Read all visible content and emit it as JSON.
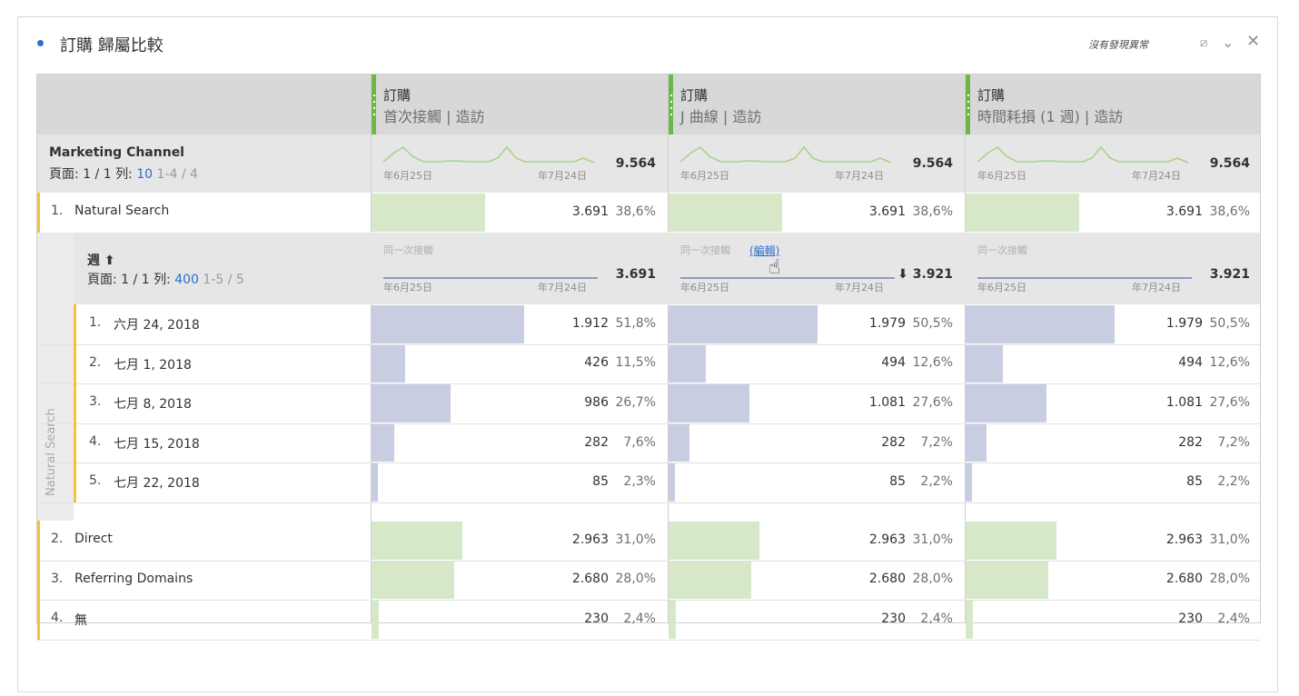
{
  "panel": {
    "title": "訂購 歸屬比較",
    "anomaly_text": "沒有發現異常",
    "controls": [
      "resize-icon",
      "chevron-down-icon",
      "close-icon"
    ]
  },
  "columns": [
    {
      "metric": "訂購",
      "model": "首次接觸 | 造訪",
      "total": "9.564",
      "sub_label": "同一次接觸",
      "sub_total": "3.691",
      "sub_total_arrow": false,
      "edit_label": ""
    },
    {
      "metric": "訂購",
      "model": "J 曲線 | 造訪",
      "total": "9.564",
      "sub_label": "同一次接觸",
      "sub_total": "3.921",
      "sub_total_arrow": true,
      "edit_label": "(編輯)"
    },
    {
      "metric": "訂購",
      "model": "時間耗損 (1 週) | 造訪",
      "total": "9.564",
      "sub_label": "同一次接觸",
      "sub_total": "3.921",
      "sub_total_arrow": false,
      "edit_label": ""
    }
  ],
  "axis_labels": {
    "start": "年6月25日",
    "end": "年7月24日"
  },
  "dimension": {
    "name": "Marketing Channel",
    "page_label": "頁面: 1 / 1",
    "rows_label": "列:",
    "rows_value": "10",
    "range": "1-4 / 4"
  },
  "breakdown": {
    "vertical_label": "Natural Search",
    "name": "週",
    "page_label": "頁面: 1 / 1",
    "rows_label": "列:",
    "rows_value": "400",
    "range": "1-5 / 5"
  },
  "top_rows": [
    {
      "idx": "1.",
      "label": "Natural Search",
      "cells": [
        {
          "v": "3.691",
          "p": "38,6%",
          "f": 0.386
        },
        {
          "v": "3.691",
          "p": "38,6%",
          "f": 0.386
        },
        {
          "v": "3.691",
          "p": "38,6%",
          "f": 0.386
        }
      ]
    },
    {
      "idx": "2.",
      "label": "Direct",
      "cells": [
        {
          "v": "2.963",
          "p": "31,0%",
          "f": 0.31
        },
        {
          "v": "2.963",
          "p": "31,0%",
          "f": 0.31
        },
        {
          "v": "2.963",
          "p": "31,0%",
          "f": 0.31
        }
      ]
    },
    {
      "idx": "3.",
      "label": "Referring Domains",
      "cells": [
        {
          "v": "2.680",
          "p": "28,0%",
          "f": 0.28
        },
        {
          "v": "2.680",
          "p": "28,0%",
          "f": 0.28
        },
        {
          "v": "2.680",
          "p": "28,0%",
          "f": 0.28
        }
      ]
    },
    {
      "idx": "4.",
      "label": "無",
      "cells": [
        {
          "v": "230",
          "p": "2,4%",
          "f": 0.024
        },
        {
          "v": "230",
          "p": "2,4%",
          "f": 0.024
        },
        {
          "v": "230",
          "p": "2,4%",
          "f": 0.024
        }
      ]
    }
  ],
  "week_rows": [
    {
      "idx": "1.",
      "label": "六月 24, 2018",
      "cells": [
        {
          "v": "1.912",
          "p": "51,8%",
          "f": 0.518
        },
        {
          "v": "1.979",
          "p": "50,5%",
          "f": 0.505
        },
        {
          "v": "1.979",
          "p": "50,5%",
          "f": 0.505
        }
      ]
    },
    {
      "idx": "2.",
      "label": "七月 1, 2018",
      "cells": [
        {
          "v": "426",
          "p": "11,5%",
          "f": 0.115
        },
        {
          "v": "494",
          "p": "12,6%",
          "f": 0.126
        },
        {
          "v": "494",
          "p": "12,6%",
          "f": 0.126
        }
      ]
    },
    {
      "idx": "3.",
      "label": "七月 8, 2018",
      "cells": [
        {
          "v": "986",
          "p": "26,7%",
          "f": 0.267
        },
        {
          "v": "1.081",
          "p": "27,6%",
          "f": 0.276
        },
        {
          "v": "1.081",
          "p": "27,6%",
          "f": 0.276
        }
      ]
    },
    {
      "idx": "4.",
      "label": "七月 15, 2018",
      "cells": [
        {
          "v": "282",
          "p": "7,6%",
          "f": 0.076
        },
        {
          "v": "282",
          "p": "7,2%",
          "f": 0.072
        },
        {
          "v": "282",
          "p": "7,2%",
          "f": 0.072
        }
      ]
    },
    {
      "idx": "5.",
      "label": "七月 22, 2018",
      "cells": [
        {
          "v": "85",
          "p": "2,3%",
          "f": 0.023
        },
        {
          "v": "85",
          "p": "2,2%",
          "f": 0.022
        },
        {
          "v": "85",
          "p": "2,2%",
          "f": 0.022
        }
      ]
    }
  ],
  "colors": {
    "accent": "#2d6fd1",
    "green_bar": "#d6e8c8",
    "purple_bar": "#c8cde2",
    "green_marker": "#6bb845",
    "row_edge": "#f5c23a",
    "sparkline": "#a7d38a",
    "flatline": "#8f9ac4"
  }
}
